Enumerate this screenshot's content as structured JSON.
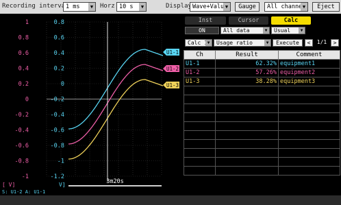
{
  "toolbar": {
    "recording_interval_label": "Recording interval",
    "recording_interval_value": "1 ms",
    "horz_label": "Horz",
    "horz_value": "10 s",
    "display_label": "Display",
    "display_value": "Wave+Value",
    "gauge_label": "Gauge",
    "channels_value": "All channels",
    "eject_label": "Eject"
  },
  "waveform": {
    "left_scale": [
      "1",
      "0.8",
      "0.6",
      "0.4",
      "0.2",
      "0",
      "-0.2",
      "-0.4",
      "-0.6",
      "-0.8",
      "-1"
    ],
    "right_scale": [
      "0.8",
      "0.6",
      "0.4",
      "0.2",
      "0",
      "-0.2",
      "-0.4",
      "-0.6",
      "-0.8",
      "-1",
      "-1.2"
    ],
    "unit_left": "[ V]",
    "unit_right": "V]",
    "channel_info": "S: U1-2  A: U1-1",
    "time_label": "3m20s",
    "markers": [
      {
        "label": "U1-1",
        "color": "#59d6f4"
      },
      {
        "label": "U1-2",
        "color": "#ef5fa8"
      },
      {
        "label": "U1-3",
        "color": "#f0d25a"
      }
    ],
    "left_scale_color": "#ef5fa8",
    "right_scale_color": "#59d6f4"
  },
  "panel": {
    "tabs": [
      {
        "label": "Inst",
        "active": false
      },
      {
        "label": "Cursor",
        "active": false
      },
      {
        "label": "Calc",
        "active": true
      }
    ],
    "on_button": "ON",
    "data_select": "All data",
    "mode_select": "Usual",
    "calc_select": "Calc 1",
    "func_select": "Usage ratio",
    "execute_button": "Execute",
    "page_prev": "<",
    "page_indicator": "1/1",
    "page_next": ">",
    "columns": [
      "Ch",
      "Result",
      "Comment"
    ],
    "rows": [
      {
        "ch": "U1-1",
        "result": "62.32%",
        "comment": "equipment1",
        "color": "#59d6f4"
      },
      {
        "ch": "U1-2",
        "result": "57.26%",
        "comment": "equipment2",
        "color": "#ef5fa8"
      },
      {
        "ch": "U1-3",
        "result": "38.28%",
        "comment": "equipment3",
        "color": "#f0d25a"
      }
    ]
  }
}
